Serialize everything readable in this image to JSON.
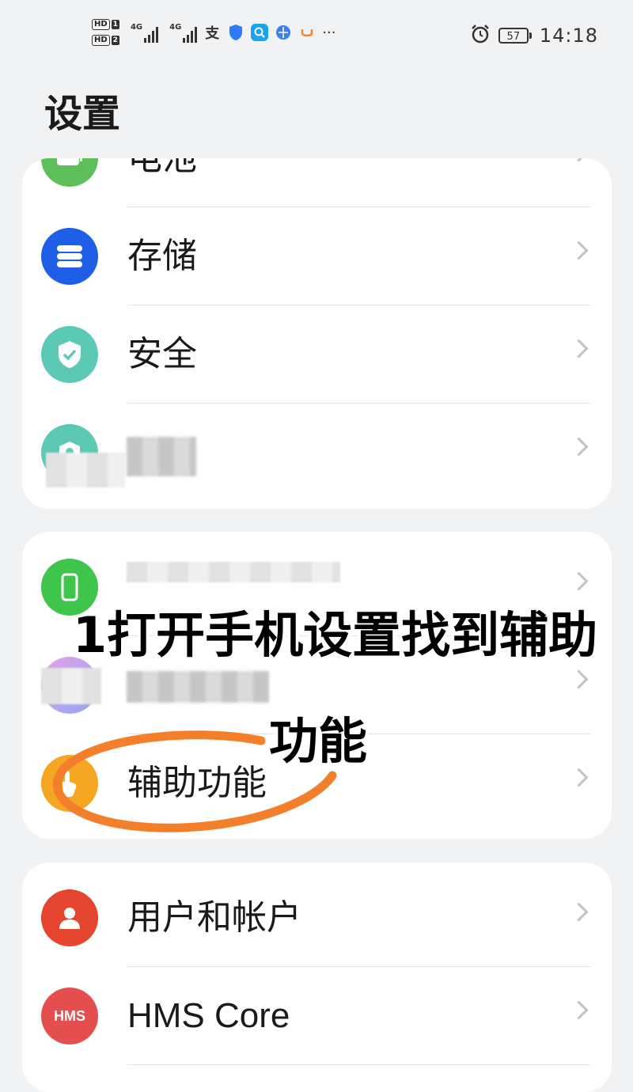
{
  "statusbar": {
    "sim1": "HD",
    "sim1_num": "1",
    "sim2": "HD",
    "sim2_num": "2",
    "net1": "4G",
    "net2": "4G",
    "more": "···",
    "battery": "57",
    "time": "14:18",
    "app_icons": [
      "alipay-icon",
      "shield-app-icon",
      "search-app-icon",
      "browser-app-icon",
      "didi-app-icon"
    ]
  },
  "page": {
    "title": "设置"
  },
  "card1": {
    "items": [
      {
        "label": "电池",
        "icon": "battery-icon",
        "color": "#5cbf5a"
      },
      {
        "label": "存储",
        "icon": "storage-icon",
        "color": "#1f5fe8"
      },
      {
        "label": "安全",
        "icon": "security-shield-icon",
        "color": "#5cc9b4"
      },
      {
        "label": "",
        "icon": "privacy-icon",
        "color": "#5cc9b4"
      }
    ]
  },
  "card2": {
    "items": [
      {
        "label": "",
        "icon": "health-icon",
        "color": "#3fc54c"
      },
      {
        "label": "",
        "icon": "assistant-icon",
        "color": "#a98cf0"
      },
      {
        "label": "辅助功能",
        "icon": "accessibility-hand-icon",
        "color": "#f5a623"
      }
    ]
  },
  "card3": {
    "items": [
      {
        "label": "用户和帐户",
        "icon": "user-icon",
        "color": "#e5442f"
      },
      {
        "label": "HMS Core",
        "icon": "hms-icon",
        "icon_text": "HMS",
        "color": "#e54e4e"
      }
    ]
  },
  "annotation": {
    "line1": "1打开手机设置找到辅助",
    "line2": "功能",
    "circle_color": "#f47f2a"
  }
}
